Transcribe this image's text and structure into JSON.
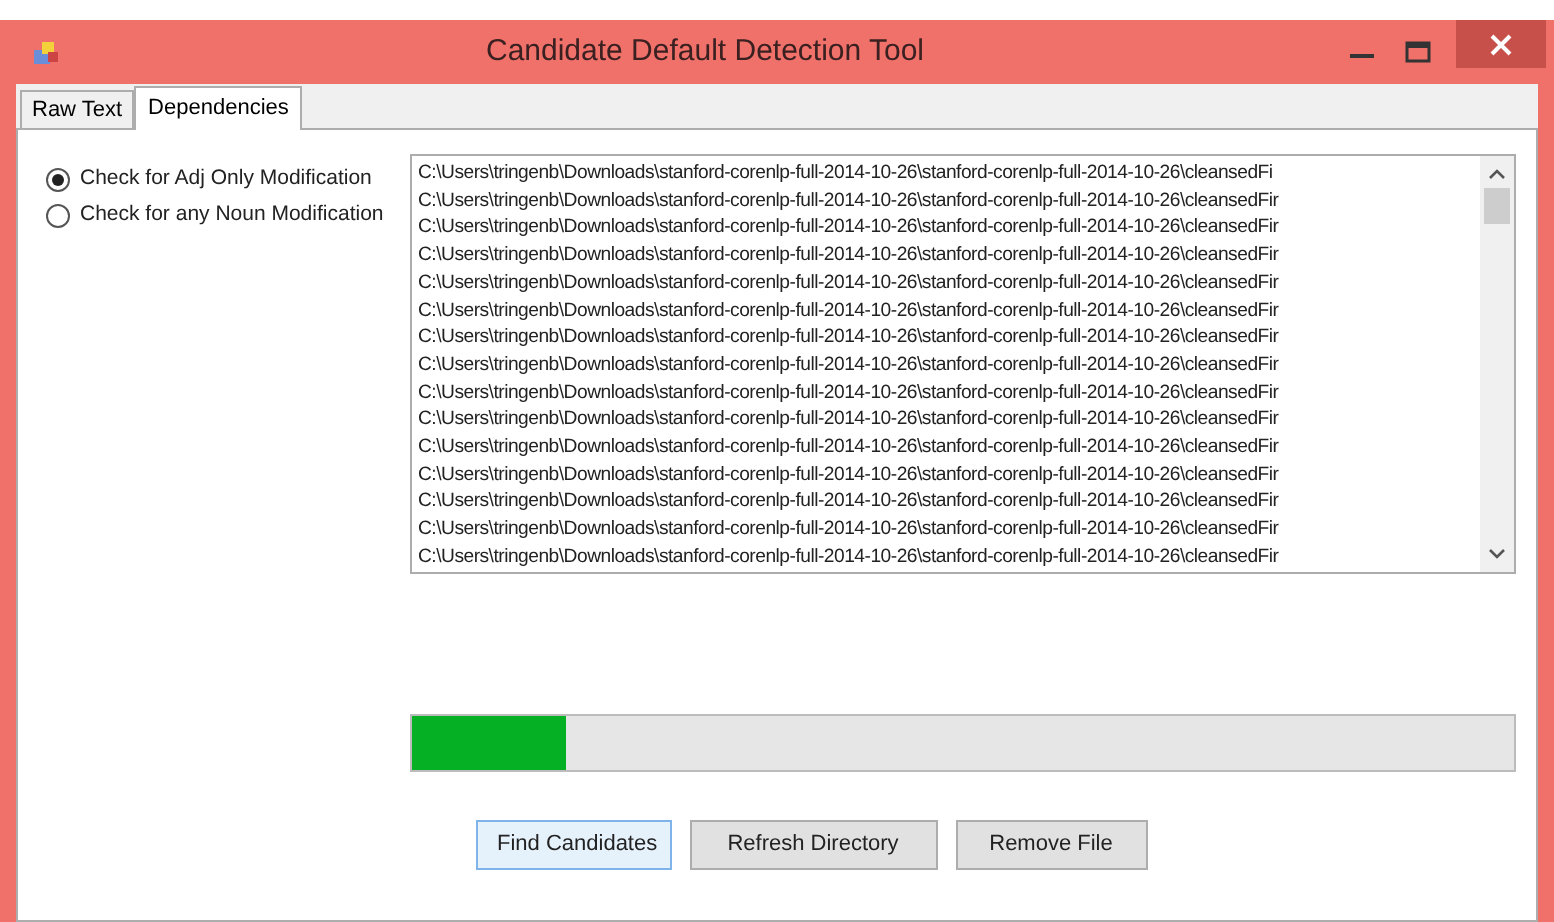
{
  "window": {
    "title": "Candidate Default Detection Tool"
  },
  "tabs": [
    {
      "label": "Raw Text",
      "selected": false
    },
    {
      "label": "Dependencies",
      "selected": true
    }
  ],
  "options": [
    {
      "label": "Check for Adj Only Modification",
      "selected": true
    },
    {
      "label": "Check for any Noun Modification",
      "selected": false
    }
  ],
  "files": [
    "C:\\Users\\tringenb\\Downloads\\stanford-corenlp-full-2014-10-26\\stanford-corenlp-full-2014-10-26\\cleansedFi",
    "C:\\Users\\tringenb\\Downloads\\stanford-corenlp-full-2014-10-26\\stanford-corenlp-full-2014-10-26\\cleansedFir",
    "C:\\Users\\tringenb\\Downloads\\stanford-corenlp-full-2014-10-26\\stanford-corenlp-full-2014-10-26\\cleansedFir",
    "C:\\Users\\tringenb\\Downloads\\stanford-corenlp-full-2014-10-26\\stanford-corenlp-full-2014-10-26\\cleansedFir",
    "C:\\Users\\tringenb\\Downloads\\stanford-corenlp-full-2014-10-26\\stanford-corenlp-full-2014-10-26\\cleansedFir",
    "C:\\Users\\tringenb\\Downloads\\stanford-corenlp-full-2014-10-26\\stanford-corenlp-full-2014-10-26\\cleansedFir",
    "C:\\Users\\tringenb\\Downloads\\stanford-corenlp-full-2014-10-26\\stanford-corenlp-full-2014-10-26\\cleansedFir",
    "C:\\Users\\tringenb\\Downloads\\stanford-corenlp-full-2014-10-26\\stanford-corenlp-full-2014-10-26\\cleansedFir",
    "C:\\Users\\tringenb\\Downloads\\stanford-corenlp-full-2014-10-26\\stanford-corenlp-full-2014-10-26\\cleansedFir",
    "C:\\Users\\tringenb\\Downloads\\stanford-corenlp-full-2014-10-26\\stanford-corenlp-full-2014-10-26\\cleansedFir",
    "C:\\Users\\tringenb\\Downloads\\stanford-corenlp-full-2014-10-26\\stanford-corenlp-full-2014-10-26\\cleansedFir",
    "C:\\Users\\tringenb\\Downloads\\stanford-corenlp-full-2014-10-26\\stanford-corenlp-full-2014-10-26\\cleansedFir",
    "C:\\Users\\tringenb\\Downloads\\stanford-corenlp-full-2014-10-26\\stanford-corenlp-full-2014-10-26\\cleansedFir",
    "C:\\Users\\tringenb\\Downloads\\stanford-corenlp-full-2014-10-26\\stanford-corenlp-full-2014-10-26\\cleansedFir",
    "C:\\Users\\tringenb\\Downloads\\stanford-corenlp-full-2014-10-26\\stanford-corenlp-full-2014-10-26\\cleansedFir"
  ],
  "progress": {
    "level": 0.14
  },
  "buttons": [
    {
      "label": "Find Candidates",
      "selected": true
    },
    {
      "label": "Refresh Directory",
      "selected": false
    },
    {
      "label": "Remove File",
      "selected": false
    }
  ]
}
